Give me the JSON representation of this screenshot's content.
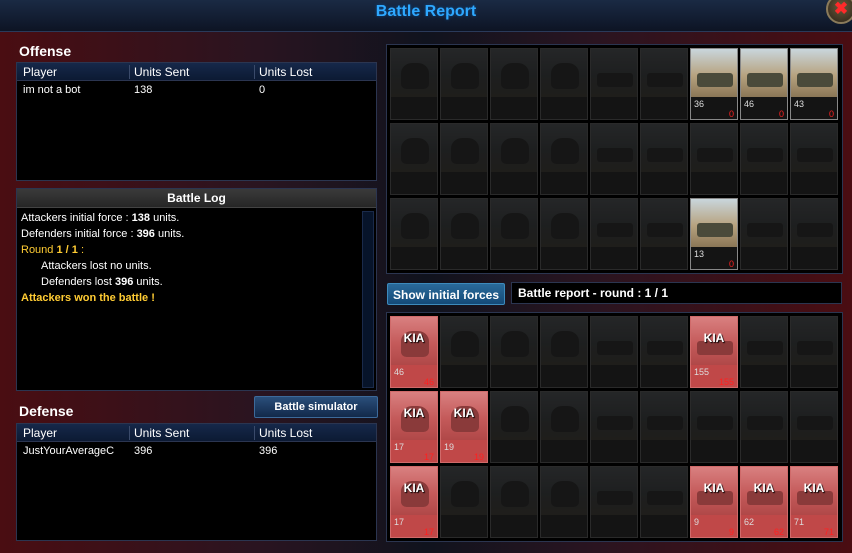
{
  "window": {
    "title": "Battle Report",
    "close_icon": "x-close-icon"
  },
  "offense": {
    "title": "Offense",
    "columns": [
      "Player",
      "Units Sent",
      "Units Lost"
    ],
    "rows": [
      {
        "player": "im not a bot",
        "sent": "138",
        "lost": "0"
      }
    ]
  },
  "battle_log": {
    "title": "Battle Log",
    "lines": [
      {
        "pre": "Attackers initial force : ",
        "bold": "138",
        "post": " units."
      },
      {
        "pre": "Defenders initial force : ",
        "bold": "396",
        "post": " units."
      },
      {
        "round": "Round ",
        "round_bold": "1 / 1",
        "round_post": " :"
      },
      {
        "indent": "Attackers lost no units."
      },
      {
        "indent_pre": "Defenders lost ",
        "indent_bold": "396",
        "indent_post": " units."
      },
      {
        "result": "Attackers won the battle !"
      }
    ]
  },
  "battle_simulator_label": "Battle simulator",
  "defense": {
    "title": "Defense",
    "columns": [
      "Player",
      "Units Sent",
      "Units Lost"
    ],
    "rows": [
      {
        "player": "JustYourAverageC",
        "sent": "396",
        "lost": "396"
      }
    ]
  },
  "show_initial_forces_label": "Show initial forces",
  "round_label": "Battle report - round : 1 / 1",
  "kia_label": "KIA",
  "attacker_grid": [
    [
      null,
      null,
      null,
      null,
      null,
      null,
      {
        "count": "36",
        "lost": "0"
      },
      {
        "count": "46",
        "lost": "0"
      },
      {
        "count": "43",
        "lost": "0"
      }
    ],
    [
      null,
      null,
      null,
      null,
      null,
      null,
      null,
      null,
      null
    ],
    [
      null,
      null,
      null,
      null,
      null,
      null,
      {
        "count": "13",
        "lost": "0"
      },
      null,
      null
    ]
  ],
  "defender_grid": [
    [
      {
        "count": "46",
        "lost": "46"
      },
      null,
      null,
      null,
      null,
      null,
      {
        "count": "155",
        "lost": "155"
      },
      null,
      null
    ],
    [
      {
        "count": "17",
        "lost": "17"
      },
      {
        "count": "19",
        "lost": "19"
      },
      null,
      null,
      null,
      null,
      null,
      null,
      null
    ],
    [
      {
        "count": "17",
        "lost": "17"
      },
      null,
      null,
      null,
      null,
      null,
      {
        "count": "9",
        "lost": "9"
      },
      {
        "count": "62",
        "lost": "62"
      },
      {
        "count": "71",
        "lost": "71"
      }
    ]
  ]
}
